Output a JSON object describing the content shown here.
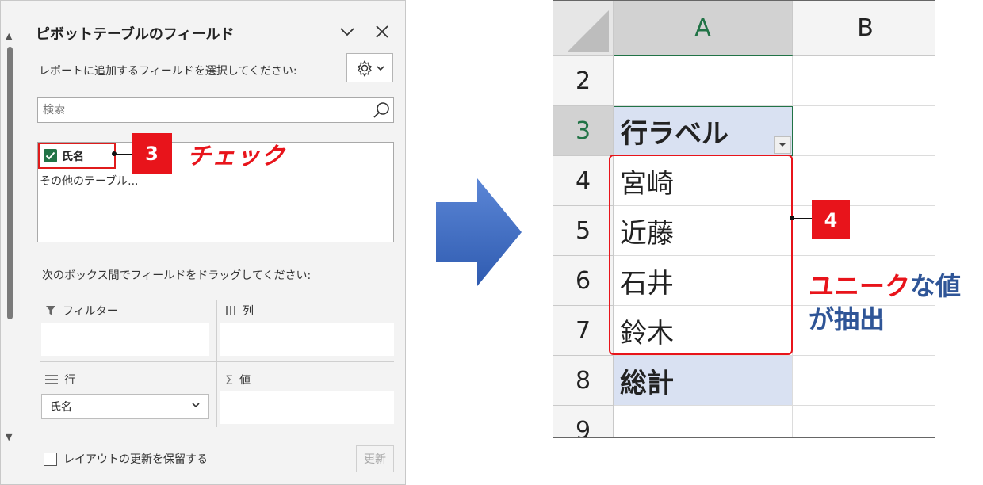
{
  "pane": {
    "title": "ピボットテーブルのフィールド",
    "instruction": "レポートに追加するフィールドを選択してください:",
    "search_placeholder": "検索",
    "fields": [
      {
        "label": "氏名",
        "checked": true
      }
    ],
    "other_tables": "その他のテーブル...",
    "drag_instruction": "次のボックス間でフィールドをドラッグしてください:",
    "areas": {
      "filter": "フィルター",
      "columns": "列",
      "rows": "行",
      "values": "値"
    },
    "row_field": "氏名",
    "defer_label": "レイアウトの更新を保留する",
    "update_button": "更新"
  },
  "callouts": {
    "step3": "3",
    "step3_text": "チェック",
    "step4": "4",
    "note_highlight": "ユニーク",
    "note_rest": "な値",
    "note_line2": "が抽出"
  },
  "sheet": {
    "columns": [
      "A",
      "B"
    ],
    "rows": [
      {
        "num": "2",
        "a": ""
      },
      {
        "num": "3",
        "a": "行ラベル"
      },
      {
        "num": "4",
        "a": "宮崎"
      },
      {
        "num": "5",
        "a": "近藤"
      },
      {
        "num": "6",
        "a": "石井"
      },
      {
        "num": "7",
        "a": "鈴木"
      },
      {
        "num": "8",
        "a": "総計"
      },
      {
        "num": "9",
        "a": ""
      }
    ]
  },
  "colors": {
    "accent_red": "#e8141b",
    "excel_green": "#217346",
    "pivot_header_fill": "#d9e1f2",
    "note_blue": "#2f5597"
  }
}
